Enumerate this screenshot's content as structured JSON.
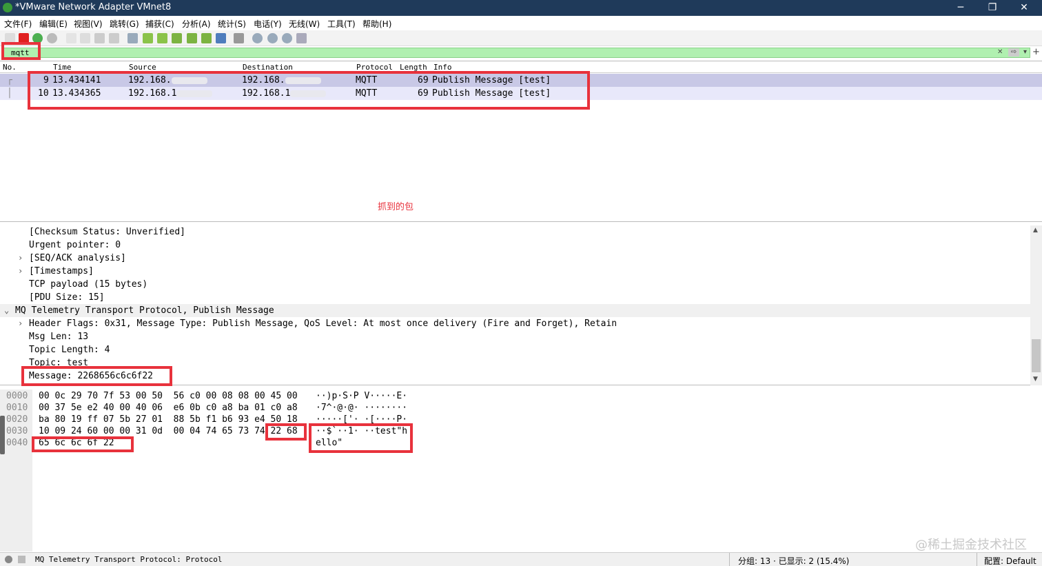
{
  "window": {
    "title": "*VMware Network Adapter VMnet8",
    "minimize": "─",
    "restore": "❐",
    "close": "✕"
  },
  "menu": [
    "文件(F)",
    "编辑(E)",
    "视图(V)",
    "跳转(G)",
    "捕获(C)",
    "分析(A)",
    "统计(S)",
    "电话(Y)",
    "无线(W)",
    "工具(T)",
    "帮助(H)"
  ],
  "filter": {
    "value": "mqtt",
    "clear_icon": "✕",
    "apply_icon": "⇨",
    "dropdown_icon": "▾",
    "add_icon": "+"
  },
  "packet_list": {
    "columns": {
      "no": "No.",
      "time": "Time",
      "source": "Source",
      "destination": "Destination",
      "protocol": "Protocol",
      "length": "Length",
      "info": "Info"
    },
    "rows": [
      {
        "no": "9",
        "time": "13.434141",
        "source": "192.168.",
        "destination": "192.168.",
        "protocol": "MQTT",
        "length": "69",
        "info": "Publish Message [test]"
      },
      {
        "no": "10",
        "time": "13.434365",
        "source": "192.168.1",
        "destination": "192.168.1",
        "protocol": "MQTT",
        "length": "69",
        "info": "Publish Message [test]"
      }
    ],
    "annotation": "抓到的包"
  },
  "details": {
    "lines": [
      {
        "caret": "",
        "text": "[Checksum Status: Unverified]"
      },
      {
        "caret": "",
        "text": "Urgent pointer: 0"
      },
      {
        "caret": "›",
        "text": "[SEQ/ACK analysis]"
      },
      {
        "caret": "›",
        "text": "[Timestamps]"
      },
      {
        "caret": "",
        "text": "TCP payload (15 bytes)"
      },
      {
        "caret": "",
        "text": "[PDU Size: 15]"
      },
      {
        "caret": "⌄",
        "text": "MQ Telemetry Transport Protocol, Publish Message"
      },
      {
        "caret": "›",
        "text": "Header Flags: 0x31, Message Type: Publish Message, QoS Level: At most once delivery (Fire and Forget), Retain"
      },
      {
        "caret": "",
        "text": "Msg Len: 13"
      },
      {
        "caret": "",
        "text": "Topic Length: 4"
      },
      {
        "caret": "",
        "text": "Topic: test"
      },
      {
        "caret": "",
        "text": "Message: 2268656c6c6f22"
      }
    ],
    "scroll_up": "▲",
    "scroll_down": "▼"
  },
  "bytes": {
    "lines": [
      {
        "offset": "0000",
        "hex": "00 0c 29 70 7f 53 00 50  56 c0 00 08 08 00 45 00",
        "ascii": "··)p·S·P V·····E·"
      },
      {
        "offset": "0010",
        "hex": "00 37 5e e2 40 00 40 06  e6 0b c0 a8 ba 01 c0 a8",
        "ascii": "·7^·@·@· ········"
      },
      {
        "offset": "0020",
        "hex": "ba 80 19 ff 07 5b 27 01  88 5b f1 b6 93 e4 50 18",
        "ascii": "·····['· ·[····P·"
      },
      {
        "offset": "0030",
        "hex": "10 09 24 60 00 00 31 0d  00 04 74 65 73 74 22 68",
        "ascii": "··$`··1· ··test\"h"
      },
      {
        "offset": "0040",
        "hex": "65 6c 6c 6f 22",
        "ascii": "ello\""
      }
    ]
  },
  "status": {
    "left": "MQ Telemetry Transport Protocol: Protocol",
    "packets": "分组: 13 · 已显示: 2 (15.4%)",
    "profile": "配置: Default"
  },
  "watermark": "@稀土掘金技术社区",
  "colors": {
    "titlebar": "#1f3a5a",
    "filter_ok": "#b0f0b0",
    "row_selected": "#c8c8e6",
    "row_normal": "#e8e8fa",
    "annotation": "#e8323c"
  }
}
